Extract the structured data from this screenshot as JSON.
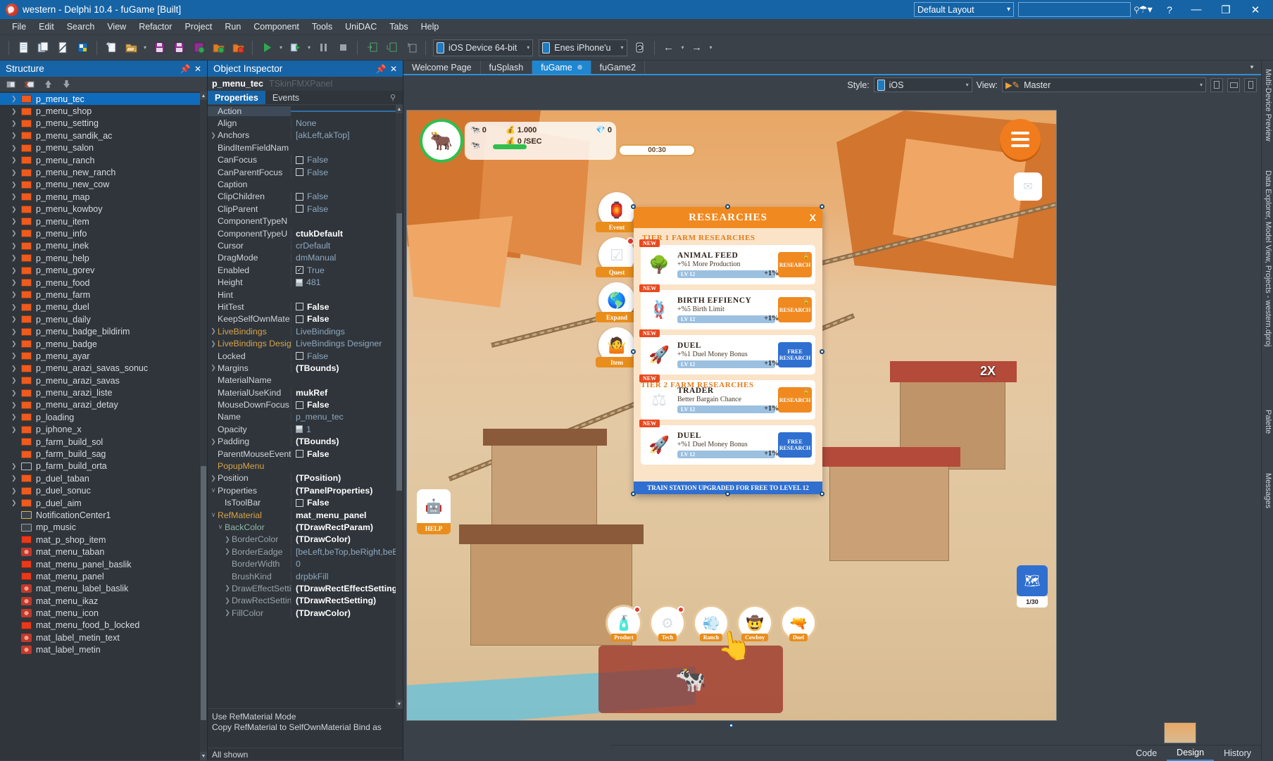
{
  "window": {
    "title": "western - Delphi 10.4 - fuGame [Built]",
    "layout_selector": "Default Layout",
    "search_placeholder": "",
    "search_value": "",
    "icons": {
      "help": "?",
      "minimize": "—",
      "restore": "❐",
      "close": "✕",
      "chevron": "∨",
      "search": "⚲"
    }
  },
  "menubar": {
    "items": [
      "File",
      "Edit",
      "Search",
      "View",
      "Refactor",
      "Project",
      "Run",
      "Component",
      "Tools",
      "UniDAC",
      "Tabs",
      "Help"
    ]
  },
  "toolbar": {
    "target_platform": "iOS Device 64-bit",
    "target_device": "Enes iPhone'u",
    "buttons": [
      "new-file",
      "open-project",
      "save-page",
      "open-project-manager",
      "new-item",
      "open-folder",
      "save",
      "save-all",
      "save-project",
      "add-to-project",
      "remove-from-project",
      "run",
      "run-without-debugging",
      "pause",
      "stop",
      "step-over",
      "step-into",
      "step-out"
    ]
  },
  "structure": {
    "title": "Structure",
    "tools": [
      "new-item-icon",
      "delete-item-icon",
      "move-up-icon",
      "move-down-icon"
    ],
    "items": [
      {
        "label": "mat_label_metin",
        "icon": "material",
        "expandable": false
      },
      {
        "label": "mat_label_metin_text",
        "icon": "material",
        "expandable": false
      },
      {
        "label": "mat_menu_food_b_locked",
        "icon": "red",
        "expandable": false
      },
      {
        "label": "mat_menu_icon",
        "icon": "material",
        "expandable": false
      },
      {
        "label": "mat_menu_ikaz",
        "icon": "material",
        "expandable": false
      },
      {
        "label": "mat_menu_label_baslik",
        "icon": "material",
        "expandable": false
      },
      {
        "label": "mat_menu_panel",
        "icon": "red",
        "expandable": false
      },
      {
        "label": "mat_menu_panel_baslik",
        "icon": "red",
        "expandable": false
      },
      {
        "label": "mat_menu_taban",
        "icon": "material",
        "expandable": false
      },
      {
        "label": "mat_p_shop_item",
        "icon": "red",
        "expandable": false
      },
      {
        "label": "mp_music",
        "icon": "film",
        "expandable": false
      },
      {
        "label": "NotificationCenter1",
        "icon": "note",
        "expandable": false
      },
      {
        "label": "p_duel_aim",
        "icon": "orange",
        "expandable": true
      },
      {
        "label": "p_duel_sonuc",
        "icon": "orange",
        "expandable": true
      },
      {
        "label": "p_duel_taban",
        "icon": "orange",
        "expandable": true
      },
      {
        "label": "p_farm_build_orta",
        "icon": "label",
        "expandable": true
      },
      {
        "label": "p_farm_build_sag",
        "icon": "orange",
        "expandable": false
      },
      {
        "label": "p_farm_build_sol",
        "icon": "orange",
        "expandable": false
      },
      {
        "label": "p_iphone_x",
        "icon": "orange",
        "expandable": true
      },
      {
        "label": "p_loading",
        "icon": "orange",
        "expandable": true
      },
      {
        "label": "p_menu_arazi_detay",
        "icon": "orange",
        "expandable": true
      },
      {
        "label": "p_menu_arazi_liste",
        "icon": "orange",
        "expandable": true
      },
      {
        "label": "p_menu_arazi_savas",
        "icon": "orange",
        "expandable": true
      },
      {
        "label": "p_menu_arazi_savas_sonuc",
        "icon": "orange",
        "expandable": true
      },
      {
        "label": "p_menu_ayar",
        "icon": "orange",
        "expandable": true
      },
      {
        "label": "p_menu_badge",
        "icon": "orange",
        "expandable": true
      },
      {
        "label": "p_menu_badge_bildirim",
        "icon": "orange",
        "expandable": true
      },
      {
        "label": "p_menu_daily",
        "icon": "orange",
        "expandable": true
      },
      {
        "label": "p_menu_duel",
        "icon": "orange",
        "expandable": true
      },
      {
        "label": "p_menu_farm",
        "icon": "orange",
        "expandable": true
      },
      {
        "label": "p_menu_food",
        "icon": "orange",
        "expandable": true
      },
      {
        "label": "p_menu_gorev",
        "icon": "orange",
        "expandable": true
      },
      {
        "label": "p_menu_help",
        "icon": "orange",
        "expandable": true
      },
      {
        "label": "p_menu_inek",
        "icon": "orange",
        "expandable": true
      },
      {
        "label": "p_menu_info",
        "icon": "orange",
        "expandable": true
      },
      {
        "label": "p_menu_item",
        "icon": "orange",
        "expandable": true
      },
      {
        "label": "p_menu_kowboy",
        "icon": "orange",
        "expandable": true
      },
      {
        "label": "p_menu_map",
        "icon": "orange",
        "expandable": true
      },
      {
        "label": "p_menu_new_cow",
        "icon": "orange",
        "expandable": true
      },
      {
        "label": "p_menu_new_ranch",
        "icon": "orange",
        "expandable": true
      },
      {
        "label": "p_menu_ranch",
        "icon": "orange",
        "expandable": true
      },
      {
        "label": "p_menu_salon",
        "icon": "orange",
        "expandable": true
      },
      {
        "label": "p_menu_sandik_ac",
        "icon": "orange",
        "expandable": true
      },
      {
        "label": "p_menu_setting",
        "icon": "orange",
        "expandable": true
      },
      {
        "label": "p_menu_shop",
        "icon": "orange",
        "expandable": true
      },
      {
        "label": "p_menu_tec",
        "icon": "orange",
        "expandable": true,
        "selected": true
      }
    ]
  },
  "inspector": {
    "title": "Object Inspector",
    "object_name": "p_menu_tec",
    "object_class": "TSkinFMXPanel",
    "tabs": [
      "Properties",
      "Events"
    ],
    "active_tab": "Properties",
    "rows": [
      {
        "name": "Action",
        "value": "",
        "kind": "text",
        "selected": true,
        "indent": 1
      },
      {
        "name": "Align",
        "value": "None",
        "kind": "text",
        "indent": 1
      },
      {
        "name": "Anchors",
        "value": "[akLeft,akTop]",
        "kind": "text",
        "indent": 1,
        "expandable": true
      },
      {
        "name": "BindItemFieldNam",
        "value": "",
        "kind": "text",
        "indent": 1
      },
      {
        "name": "CanFocus",
        "value": "False",
        "kind": "checkbox",
        "checked": false,
        "indent": 1
      },
      {
        "name": "CanParentFocus",
        "value": "False",
        "kind": "checkbox",
        "checked": false,
        "indent": 1
      },
      {
        "name": "Caption",
        "value": "",
        "kind": "text",
        "indent": 1
      },
      {
        "name": "ClipChildren",
        "value": "False",
        "kind": "checkbox",
        "checked": false,
        "indent": 1
      },
      {
        "name": "ClipParent",
        "value": "False",
        "kind": "checkbox",
        "checked": false,
        "indent": 1
      },
      {
        "name": "ComponentTypeN",
        "value": "",
        "kind": "text",
        "indent": 1
      },
      {
        "name": "ComponentTypeU",
        "value": "ctukDefault",
        "kind": "bold",
        "indent": 1
      },
      {
        "name": "Cursor",
        "value": "crDefault",
        "kind": "text",
        "indent": 1
      },
      {
        "name": "DragMode",
        "value": "dmManual",
        "kind": "text",
        "indent": 1
      },
      {
        "name": "Enabled",
        "value": "True",
        "kind": "checkbox",
        "checked": true,
        "indent": 1
      },
      {
        "name": "Height",
        "value": "481",
        "kind": "number",
        "indent": 1
      },
      {
        "name": "Hint",
        "value": "",
        "kind": "text",
        "indent": 1
      },
      {
        "name": "HitTest",
        "value": "False",
        "kind": "checkbox",
        "checked": false,
        "bold": true,
        "indent": 1
      },
      {
        "name": "KeepSelfOwnMate",
        "value": "False",
        "kind": "checkbox",
        "checked": false,
        "bold": true,
        "indent": 1
      },
      {
        "name": "LiveBindings",
        "value": "LiveBindings",
        "kind": "text",
        "indent": 1,
        "expandable": true,
        "group": true
      },
      {
        "name": "LiveBindings Desig",
        "value": "LiveBindings Designer",
        "kind": "text",
        "indent": 1,
        "expandable": true,
        "group": true
      },
      {
        "name": "Locked",
        "value": "False",
        "kind": "checkbox",
        "checked": false,
        "indent": 1
      },
      {
        "name": "Margins",
        "value": "(TBounds)",
        "kind": "bold",
        "indent": 1,
        "expandable": true
      },
      {
        "name": "MaterialName",
        "value": "",
        "kind": "text",
        "indent": 1
      },
      {
        "name": "MaterialUseKind",
        "value": "mukRef",
        "kind": "bold",
        "indent": 1
      },
      {
        "name": "MouseDownFocus",
        "value": "False",
        "kind": "checkbox",
        "checked": false,
        "bold": true,
        "indent": 1
      },
      {
        "name": "Name",
        "value": "p_menu_tec",
        "kind": "text",
        "indent": 1
      },
      {
        "name": "Opacity",
        "value": "1",
        "kind": "number",
        "indent": 1
      },
      {
        "name": "Padding",
        "value": "(TBounds)",
        "kind": "bold",
        "indent": 1,
        "expandable": true
      },
      {
        "name": "ParentMouseEvent",
        "value": "False",
        "kind": "checkbox",
        "checked": false,
        "bold": true,
        "indent": 1
      },
      {
        "name": "PopupMenu",
        "value": "",
        "kind": "text",
        "indent": 1,
        "group": true
      },
      {
        "name": "Position",
        "value": "(TPosition)",
        "kind": "bold",
        "indent": 1,
        "expandable": true
      },
      {
        "name": "Properties",
        "value": "(TPanelProperties)",
        "kind": "bold",
        "indent": 1,
        "expanded": true
      },
      {
        "name": "IsToolBar",
        "value": "False",
        "kind": "checkbox",
        "checked": false,
        "bold": true,
        "indent": 2
      },
      {
        "name": "RefMaterial",
        "value": "mat_menu_panel",
        "kind": "bold",
        "indent": 1,
        "expanded": true,
        "group": true
      },
      {
        "name": "BackColor",
        "value": "(TDrawRectParam)",
        "kind": "bold",
        "indent": 2,
        "expanded": true,
        "sub": true
      },
      {
        "name": "BorderColor",
        "value": "(TDrawColor)",
        "kind": "bold",
        "indent": 3,
        "expandable": true,
        "sub": true
      },
      {
        "name": "BorderEadge",
        "value": "[beLeft,beTop,beRight,beBotto",
        "kind": "text",
        "indent": 3,
        "expandable": true,
        "sub": true
      },
      {
        "name": "BorderWidth",
        "value": "0",
        "kind": "text",
        "indent": 3,
        "sub": true
      },
      {
        "name": "BrushKind",
        "value": "drpbkFill",
        "kind": "text",
        "indent": 3,
        "sub": true
      },
      {
        "name": "DrawEffectSetting",
        "value": "(TDrawRectEffectSetting)",
        "kind": "bold",
        "indent": 3,
        "expandable": true,
        "sub": true
      },
      {
        "name": "DrawRectSetting",
        "value": "(TDrawRectSetting)",
        "kind": "bold",
        "indent": 3,
        "expandable": true,
        "sub": true
      },
      {
        "name": "FillColor",
        "value": "(TDrawColor)",
        "kind": "bold",
        "indent": 3,
        "expandable": true,
        "sub": true
      }
    ],
    "hint": "Use RefMaterial Mode\nCopy RefMaterial to SelfOwnMaterial Bind as",
    "footer": "All shown"
  },
  "designer": {
    "tabs": [
      {
        "label": "Welcome Page",
        "active": false
      },
      {
        "label": "fuSplash",
        "active": false
      },
      {
        "label": "fuGame",
        "active": true,
        "dot": true
      },
      {
        "label": "fuGame2",
        "active": false
      }
    ],
    "style_label": "Style:",
    "style_value": "iOS",
    "view_label": "View:",
    "view_value": "Master",
    "bottom_tabs": [
      {
        "label": "Code",
        "active": false
      },
      {
        "label": "Design",
        "active": true
      },
      {
        "label": "History",
        "active": false
      }
    ]
  },
  "right_rail": {
    "tabs": [
      "Multi-Device Preview",
      "Data Explorer, Model View, Projects - western.dproj",
      "Palette",
      "Messages"
    ]
  },
  "game": {
    "hud": {
      "coins": "1.000",
      "per_sec": "0 /SEC",
      "cow_count": "0",
      "beef_count": "0",
      "timer": "00:30",
      "menu_icon": "hamburger-icon"
    },
    "side_buttons": [
      {
        "label": "Event",
        "icon": "event-icon",
        "badge": false
      },
      {
        "label": "Quest",
        "icon": "quest-icon",
        "badge": true
      },
      {
        "label": "Expand",
        "icon": "expand-icon",
        "badge": false
      },
      {
        "label": "Item",
        "icon": "item-icon",
        "badge": false
      }
    ],
    "help_label": "HELP",
    "minimap_label": "1/30",
    "multiplier": "2X",
    "bottom_nav": [
      {
        "label": "Product",
        "icon": "product-icon",
        "badge": true
      },
      {
        "label": "Tech",
        "icon": "tech-icon",
        "badge": true
      },
      {
        "label": "Ranch",
        "icon": "ranch-icon",
        "badge": false
      },
      {
        "label": "Cowboy",
        "icon": "cowboy-icon",
        "badge": false
      },
      {
        "label": "Duel",
        "icon": "duel-icon",
        "badge": false
      }
    ],
    "researches": {
      "title": "RESEARCHES",
      "close_icon": "X",
      "tier1_label": "TIER 1 FARM RESEARCHES",
      "tier2_label": "TIER 2 FARM RESEARCHES",
      "ticker": "TRAIN STATION UPGRADED FOR FREE TO LEVEL 12",
      "items": [
        {
          "badge": "NEW",
          "name": "ANIMAL FEED",
          "desc": "+%1 More Production",
          "level": "LV 12",
          "pct": "+1%",
          "button": "RESEARCH",
          "button_style": "orange",
          "locked": true,
          "icon": "tree-icon"
        },
        {
          "badge": "NEW",
          "name": "BIRTH EFFIENCY",
          "desc": "+%5 Birth Limit",
          "level": "LV 12",
          "pct": "+1%",
          "button": "RESEARCH",
          "button_style": "orange",
          "locked": true,
          "icon": "rope-icon"
        },
        {
          "badge": "NEW",
          "name": "DUEL",
          "desc": "+%1 Duel Money Bonus",
          "level": "LV 12",
          "pct": "+1%",
          "button": "FREE RESEARCH",
          "button_style": "blue",
          "locked": false,
          "icon": "gun-icon"
        },
        {
          "badge": "NEW",
          "name": "TRADER",
          "desc": "Better Bargain Chance",
          "level": "LV 12",
          "pct": "+1%",
          "button": "RESEARCH",
          "button_style": "orange",
          "locked": true,
          "icon": "scale-icon"
        },
        {
          "badge": "NEW",
          "name": "DUEL",
          "desc": "+%1 Duel Money Bonus",
          "level": "LV 12",
          "pct": "+1%",
          "button": "FREE RESEARCH",
          "button_style": "blue",
          "locked": false,
          "icon": "gun-icon"
        }
      ]
    }
  }
}
